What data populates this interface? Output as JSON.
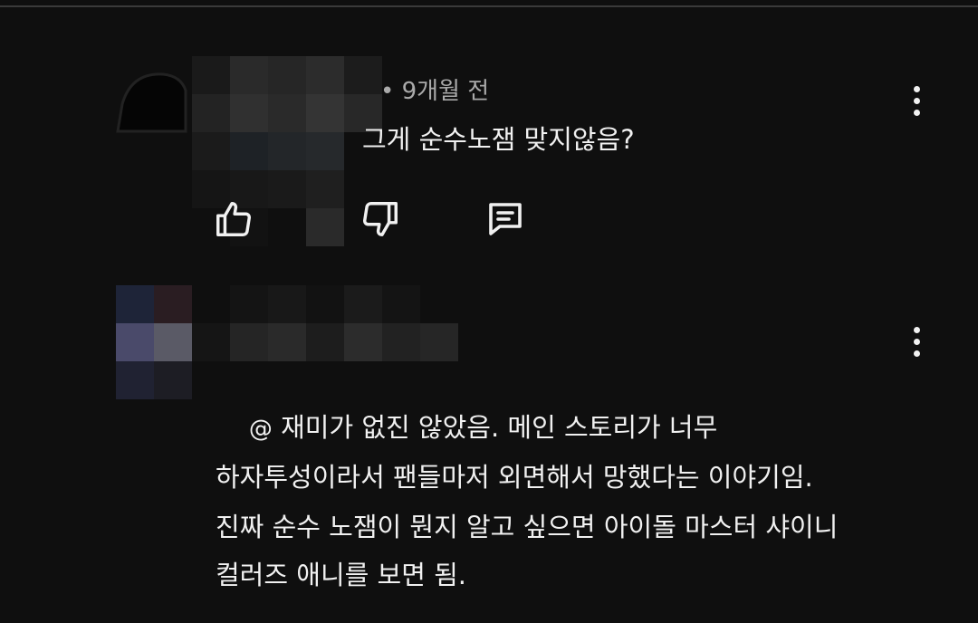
{
  "comments": [
    {
      "timestamp": "• 9개월 전",
      "text": "그게 순수노잼 맞지않음?",
      "actions": {
        "like_icon": "thumbs-up-icon",
        "dislike_icon": "thumbs-down-icon",
        "reply_icon": "reply-comment-icon"
      },
      "menu_icon": "more-vert-icon"
    },
    {
      "mention_symbol": "@",
      "paragraph1": " 재미가 없진 않았음. 메인 스토리가 너무\n하자투성이라서 팬들마저 외면해서 망했다는 이야기임.",
      "paragraph2": "진짜 순수 노잼이 뭔지 알고 싶으면 아이돌 마스터 샤이니\n컬러즈 애니를 보면 됨.",
      "menu_icon": "more-vert-icon"
    }
  ],
  "colors": {
    "background": "#0f0f0f",
    "text_primary": "#f1f1f1",
    "text_secondary": "#aaaaaa",
    "divider": "#3a3a3a"
  }
}
